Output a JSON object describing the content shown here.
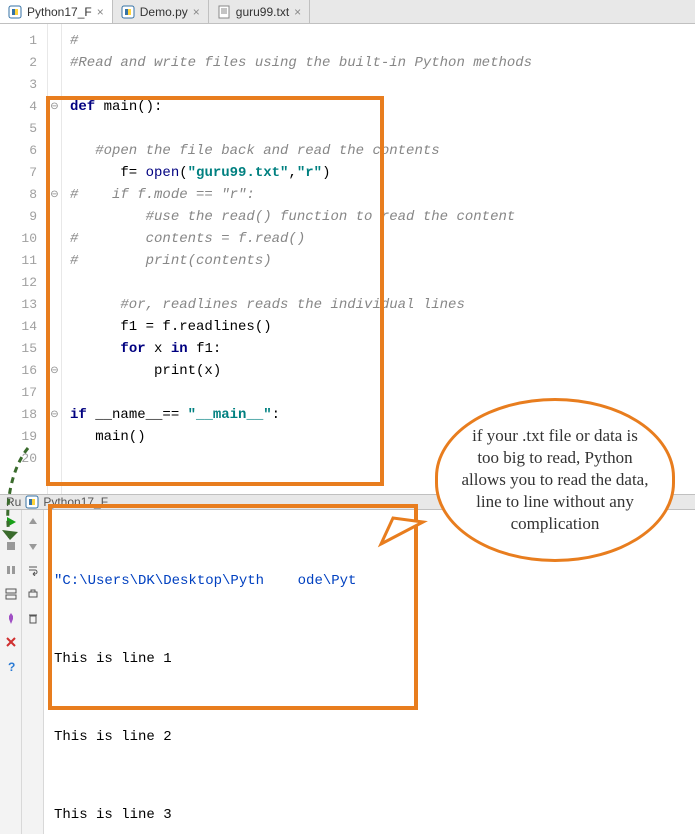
{
  "tabs": [
    {
      "label": "Python17_F",
      "icon": "py",
      "active": true
    },
    {
      "label": "Demo.py",
      "icon": "py",
      "active": false
    },
    {
      "label": "guru99.txt",
      "icon": "txt",
      "active": false
    }
  ],
  "editor": {
    "line_count": 20,
    "code_lines": [
      {
        "frags": [
          {
            "t": "#",
            "cls": "c-comment"
          }
        ]
      },
      {
        "frags": [
          {
            "t": "#Read and write files using the built-in Python methods",
            "cls": "c-comment"
          }
        ]
      },
      {
        "frags": []
      },
      {
        "frags": [
          {
            "t": "def ",
            "cls": "c-kw"
          },
          {
            "t": "main():",
            "cls": "c-func"
          }
        ]
      },
      {
        "frags": []
      },
      {
        "frags": [
          {
            "t": "   #open the file back and read the contents",
            "cls": "c-comment"
          }
        ]
      },
      {
        "frags": [
          {
            "t": "      f= ",
            "cls": "c-op"
          },
          {
            "t": "open",
            "cls": "c-builtin"
          },
          {
            "t": "(",
            "cls": "c-op"
          },
          {
            "t": "\"guru99.txt\"",
            "cls": "c-str"
          },
          {
            "t": ",",
            "cls": "c-op"
          },
          {
            "t": "\"r\"",
            "cls": "c-str"
          },
          {
            "t": ")",
            "cls": "c-op"
          }
        ]
      },
      {
        "frags": [
          {
            "t": "#    if f.mode == \"r\":",
            "cls": "c-comment"
          }
        ]
      },
      {
        "frags": [
          {
            "t": "         #use the read() function to read the content",
            "cls": "c-comment"
          }
        ]
      },
      {
        "frags": [
          {
            "t": "#        contents = f.read()",
            "cls": "c-comment"
          }
        ]
      },
      {
        "frags": [
          {
            "t": "#        print(contents)",
            "cls": "c-comment"
          }
        ]
      },
      {
        "frags": []
      },
      {
        "frags": [
          {
            "t": "      #or, readlines reads the individual lines",
            "cls": "c-comment"
          }
        ]
      },
      {
        "frags": [
          {
            "t": "      f1 = f.readlines()",
            "cls": "c-op"
          }
        ]
      },
      {
        "frags": [
          {
            "t": "      ",
            "cls": "c-op"
          },
          {
            "t": "for ",
            "cls": "c-kw"
          },
          {
            "t": "x ",
            "cls": "c-op"
          },
          {
            "t": "in ",
            "cls": "c-kw"
          },
          {
            "t": "f1:",
            "cls": "c-op"
          }
        ]
      },
      {
        "frags": [
          {
            "t": "          print(x)",
            "cls": "c-op"
          }
        ]
      },
      {
        "frags": []
      },
      {
        "frags": [
          {
            "t": "if ",
            "cls": "c-kw"
          },
          {
            "t": "__name__== ",
            "cls": "c-op"
          },
          {
            "t": "\"__main__\"",
            "cls": "c-str"
          },
          {
            "t": ":",
            "cls": "c-op"
          }
        ]
      },
      {
        "frags": [
          {
            "t": "   main()",
            "cls": "c-op"
          }
        ]
      },
      {
        "frags": []
      }
    ]
  },
  "run": {
    "tab_label_prefix": "Ru",
    "tab_label": "Python17_F",
    "console_path": "\"C:\\Users\\DK\\Desktop\\Pyth    ode\\Pyt",
    "console_lines": [
      "This is line 1",
      "",
      "",
      "This is line 2",
      "",
      "",
      "This is line 3"
    ]
  },
  "callout": {
    "text": "if your .txt file or data is too big to read, Python allows you to read the data, line to line without any complication"
  },
  "toolbar_icons": {
    "run": "run-icon",
    "stop": "stop-icon",
    "pause": "pause-icon",
    "layout": "layout-icon",
    "pin": "pin-icon",
    "close": "close-icon",
    "help": "help-icon",
    "up": "up-icon",
    "down": "down-icon",
    "wrap": "wrap-icon",
    "print": "print-icon",
    "trash": "trash-icon"
  }
}
